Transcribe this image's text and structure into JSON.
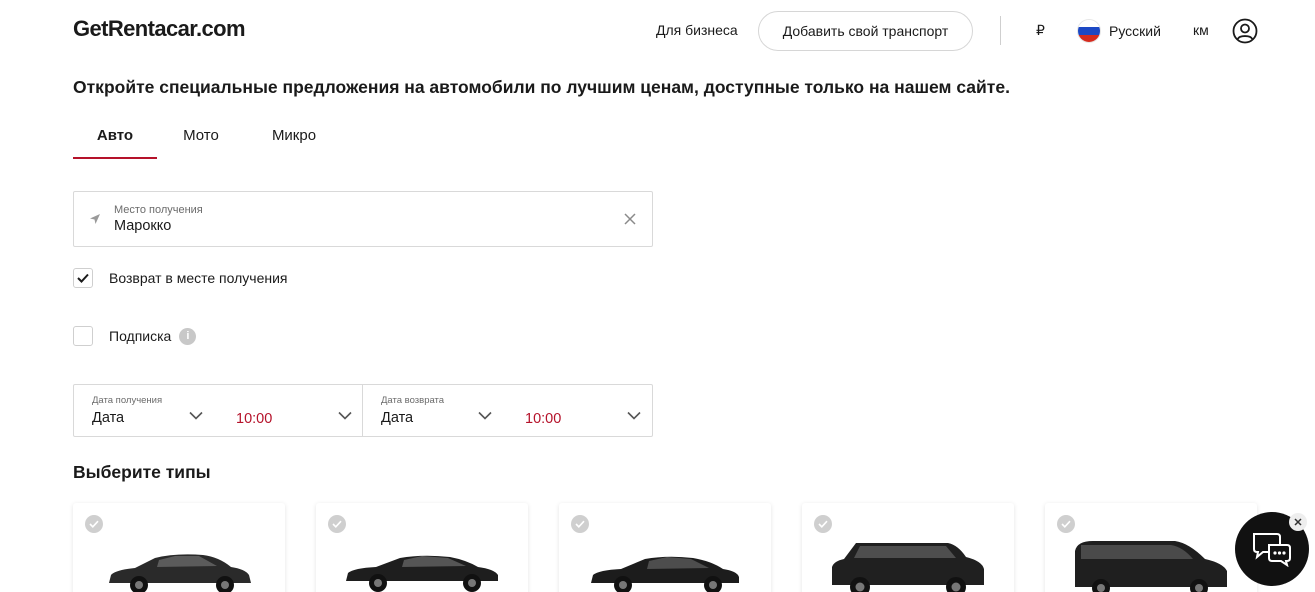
{
  "header": {
    "logo": "GetRentacar.com",
    "for_business": "Для бизнеса",
    "add_transport": "Добавить свой транспорт",
    "currency": "₽",
    "language": "Русский",
    "units": "км"
  },
  "headline": "Откройте специальные предложения на автомобили по лучшим ценам, доступные только на нашем сайте.",
  "tabs": [
    {
      "label": "Авто",
      "active": true
    },
    {
      "label": "Мото",
      "active": false
    },
    {
      "label": "Микро",
      "active": false
    }
  ],
  "location": {
    "label": "Место получения",
    "value": "Марокко"
  },
  "options": {
    "return_same": {
      "label": "Возврат в месте получения",
      "checked": true
    },
    "subscription": {
      "label": "Подписка",
      "checked": false
    }
  },
  "dates": {
    "pickup": {
      "label": "Дата получения",
      "date": "Дата",
      "time": "10:00"
    },
    "return": {
      "label": "Дата возврата",
      "date": "Дата",
      "time": "10:00"
    }
  },
  "types_title": "Выберите типы",
  "car_types": [
    {
      "icon": "sedan-car-icon"
    },
    {
      "icon": "business-sedan-car-icon"
    },
    {
      "icon": "luxury-sedan-car-icon"
    },
    {
      "icon": "suv-car-icon"
    },
    {
      "icon": "minivan-car-icon"
    }
  ],
  "colors": {
    "accent": "#b5122a",
    "text": "#1a1a1a",
    "border": "#d9d9d9",
    "chat_bg": "#111111"
  }
}
